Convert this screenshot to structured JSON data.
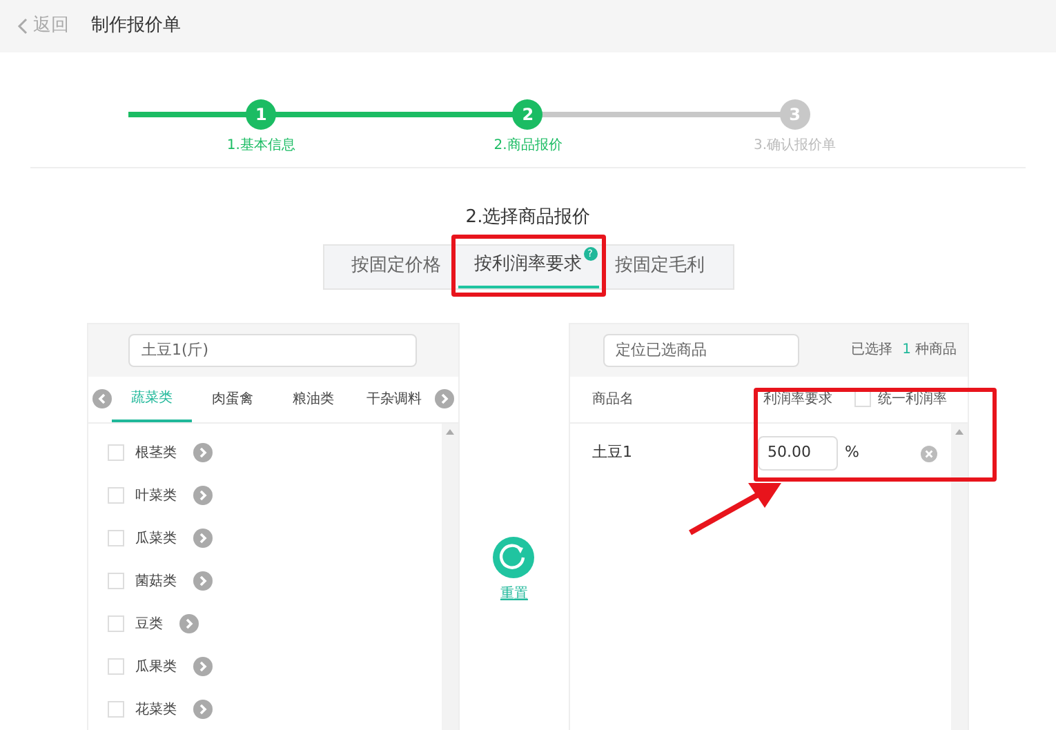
{
  "header": {
    "back": "返回",
    "title": "制作报价单"
  },
  "steps": [
    {
      "number": "1",
      "label": "1.基本信息",
      "done": true
    },
    {
      "number": "2",
      "label": "2.商品报价",
      "done": true
    },
    {
      "number": "3",
      "label": "3.确认报价单",
      "done": false
    }
  ],
  "section_title": "2.选择商品报价",
  "mode_tabs": [
    {
      "label": "按固定价格",
      "selected": false
    },
    {
      "label": "按利润率要求",
      "selected": true,
      "help": "?"
    },
    {
      "label": "按固定毛利",
      "selected": false
    }
  ],
  "left_panel": {
    "search": {
      "value": "土豆1(斤)"
    },
    "categories": [
      {
        "label": "蔬菜类",
        "selected": true
      },
      {
        "label": "肉蛋禽",
        "selected": false
      },
      {
        "label": "粮油类",
        "selected": false
      },
      {
        "label": "干杂调料",
        "selected": false
      }
    ],
    "items": [
      {
        "label": "根茎类",
        "checked": false
      },
      {
        "label": "叶菜类",
        "checked": false
      },
      {
        "label": "瓜菜类",
        "checked": false
      },
      {
        "label": "菌菇类",
        "checked": false
      },
      {
        "label": "豆类",
        "checked": false
      },
      {
        "label": "瓜果类",
        "checked": false
      },
      {
        "label": "花菜类",
        "checked": false
      }
    ]
  },
  "reset_button": "重置",
  "right_panel": {
    "search": {
      "placeholder": "定位已选商品"
    },
    "selected_prefix": "已选择",
    "selected_count": "1",
    "selected_suffix": "种商品",
    "columns": [
      "商品名",
      "利润率要求"
    ],
    "unify": {
      "label": "统一利润率",
      "checked": false
    },
    "rows": [
      {
        "name": "土豆1",
        "rate": "50.00",
        "unit": "%"
      }
    ]
  }
}
